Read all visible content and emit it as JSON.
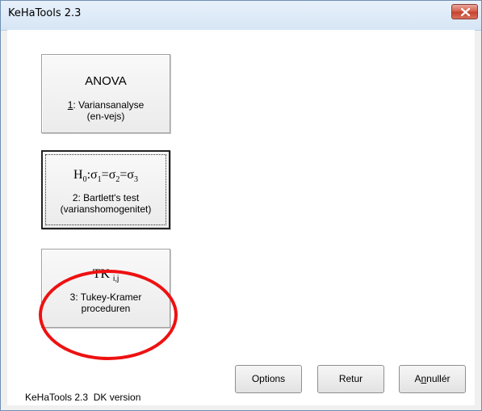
{
  "window": {
    "title": "KeHaTools 2.3"
  },
  "buttons": {
    "anova": {
      "heading": "ANOVA",
      "sub_key": "1",
      "sub_rest": ": Variansanalyse",
      "sub_line2": "(en-vejs)"
    },
    "bartlett": {
      "heading_prefix": "H",
      "h_sub": "0",
      "colon": ":",
      "sigma": "σ",
      "s1": "1",
      "eq1": "=",
      "s2": "2",
      "eq2": "=",
      "s3": "3",
      "sub_line1": "2: Bartlett's test",
      "sub_line2": "(varianshomogenitet)"
    },
    "tukey": {
      "heading": "TK",
      "heading_sub": "i,j",
      "sub_line1": "3: Tukey-Kramer",
      "sub_line2": "proceduren"
    }
  },
  "actions": {
    "options": "Options",
    "retur": "Retur",
    "annuller_prefix": "A",
    "annuller_key": "n",
    "annuller_rest": "nullér"
  },
  "status": "KeHaTools 2.3  DK version",
  "annotation": {
    "color": "#ee1111"
  }
}
